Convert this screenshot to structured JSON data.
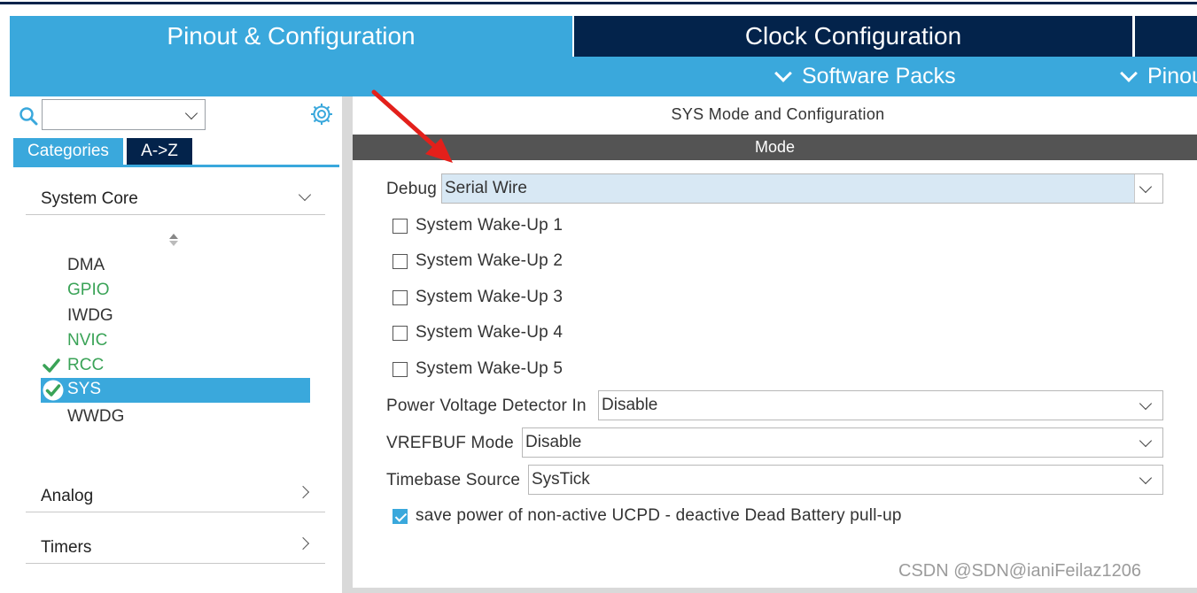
{
  "tabs": {
    "pinout": "Pinout & Configuration",
    "clock": "Clock Configuration"
  },
  "submenu": {
    "software_packs": "Software Packs",
    "pinout": "Pinout"
  },
  "left": {
    "search": {
      "value": "",
      "placeholder": ""
    },
    "view_tabs": [
      "Categories",
      "A->Z"
    ],
    "groups": {
      "system_core": "System Core",
      "analog": "Analog",
      "timers": "Timers"
    },
    "peripherals": [
      "DMA",
      "GPIO",
      "IWDG",
      "NVIC",
      "RCC",
      "SYS",
      "WWDG"
    ],
    "selected": "SYS"
  },
  "right": {
    "title": "SYS Mode and Configuration",
    "section": "Mode",
    "debug": {
      "label": "Debug",
      "value": "Serial Wire"
    },
    "wakeups": [
      {
        "label": "System Wake-Up 1",
        "checked": false
      },
      {
        "label": "System Wake-Up 2",
        "checked": false
      },
      {
        "label": "System Wake-Up 3",
        "checked": false
      },
      {
        "label": "System Wake-Up 4",
        "checked": false
      },
      {
        "label": "System Wake-Up 5",
        "checked": false
      }
    ],
    "pvd": {
      "label": "Power Voltage Detector In",
      "value": "Disable"
    },
    "vrefbuf": {
      "label": "VREFBUF Mode",
      "value": "Disable"
    },
    "timebase": {
      "label": "Timebase Source",
      "value": "SysTick"
    },
    "ucpd": {
      "label": "save power of non-active UCPD - deactive Dead Battery pull-up",
      "checked": true
    }
  },
  "watermark": "CSDN @SDN@ianiFeilaz1206",
  "colors": {
    "active_tab": "#3aa8dc",
    "inactive_tab": "#03234b",
    "mode_bar": "#545454",
    "green_text": "#3aa357",
    "annotation_arrow": "#e3201b"
  },
  "icons": {
    "search": "search-icon",
    "settings": "gear-icon",
    "sort": "sort-icon",
    "ok": "check-icon"
  }
}
